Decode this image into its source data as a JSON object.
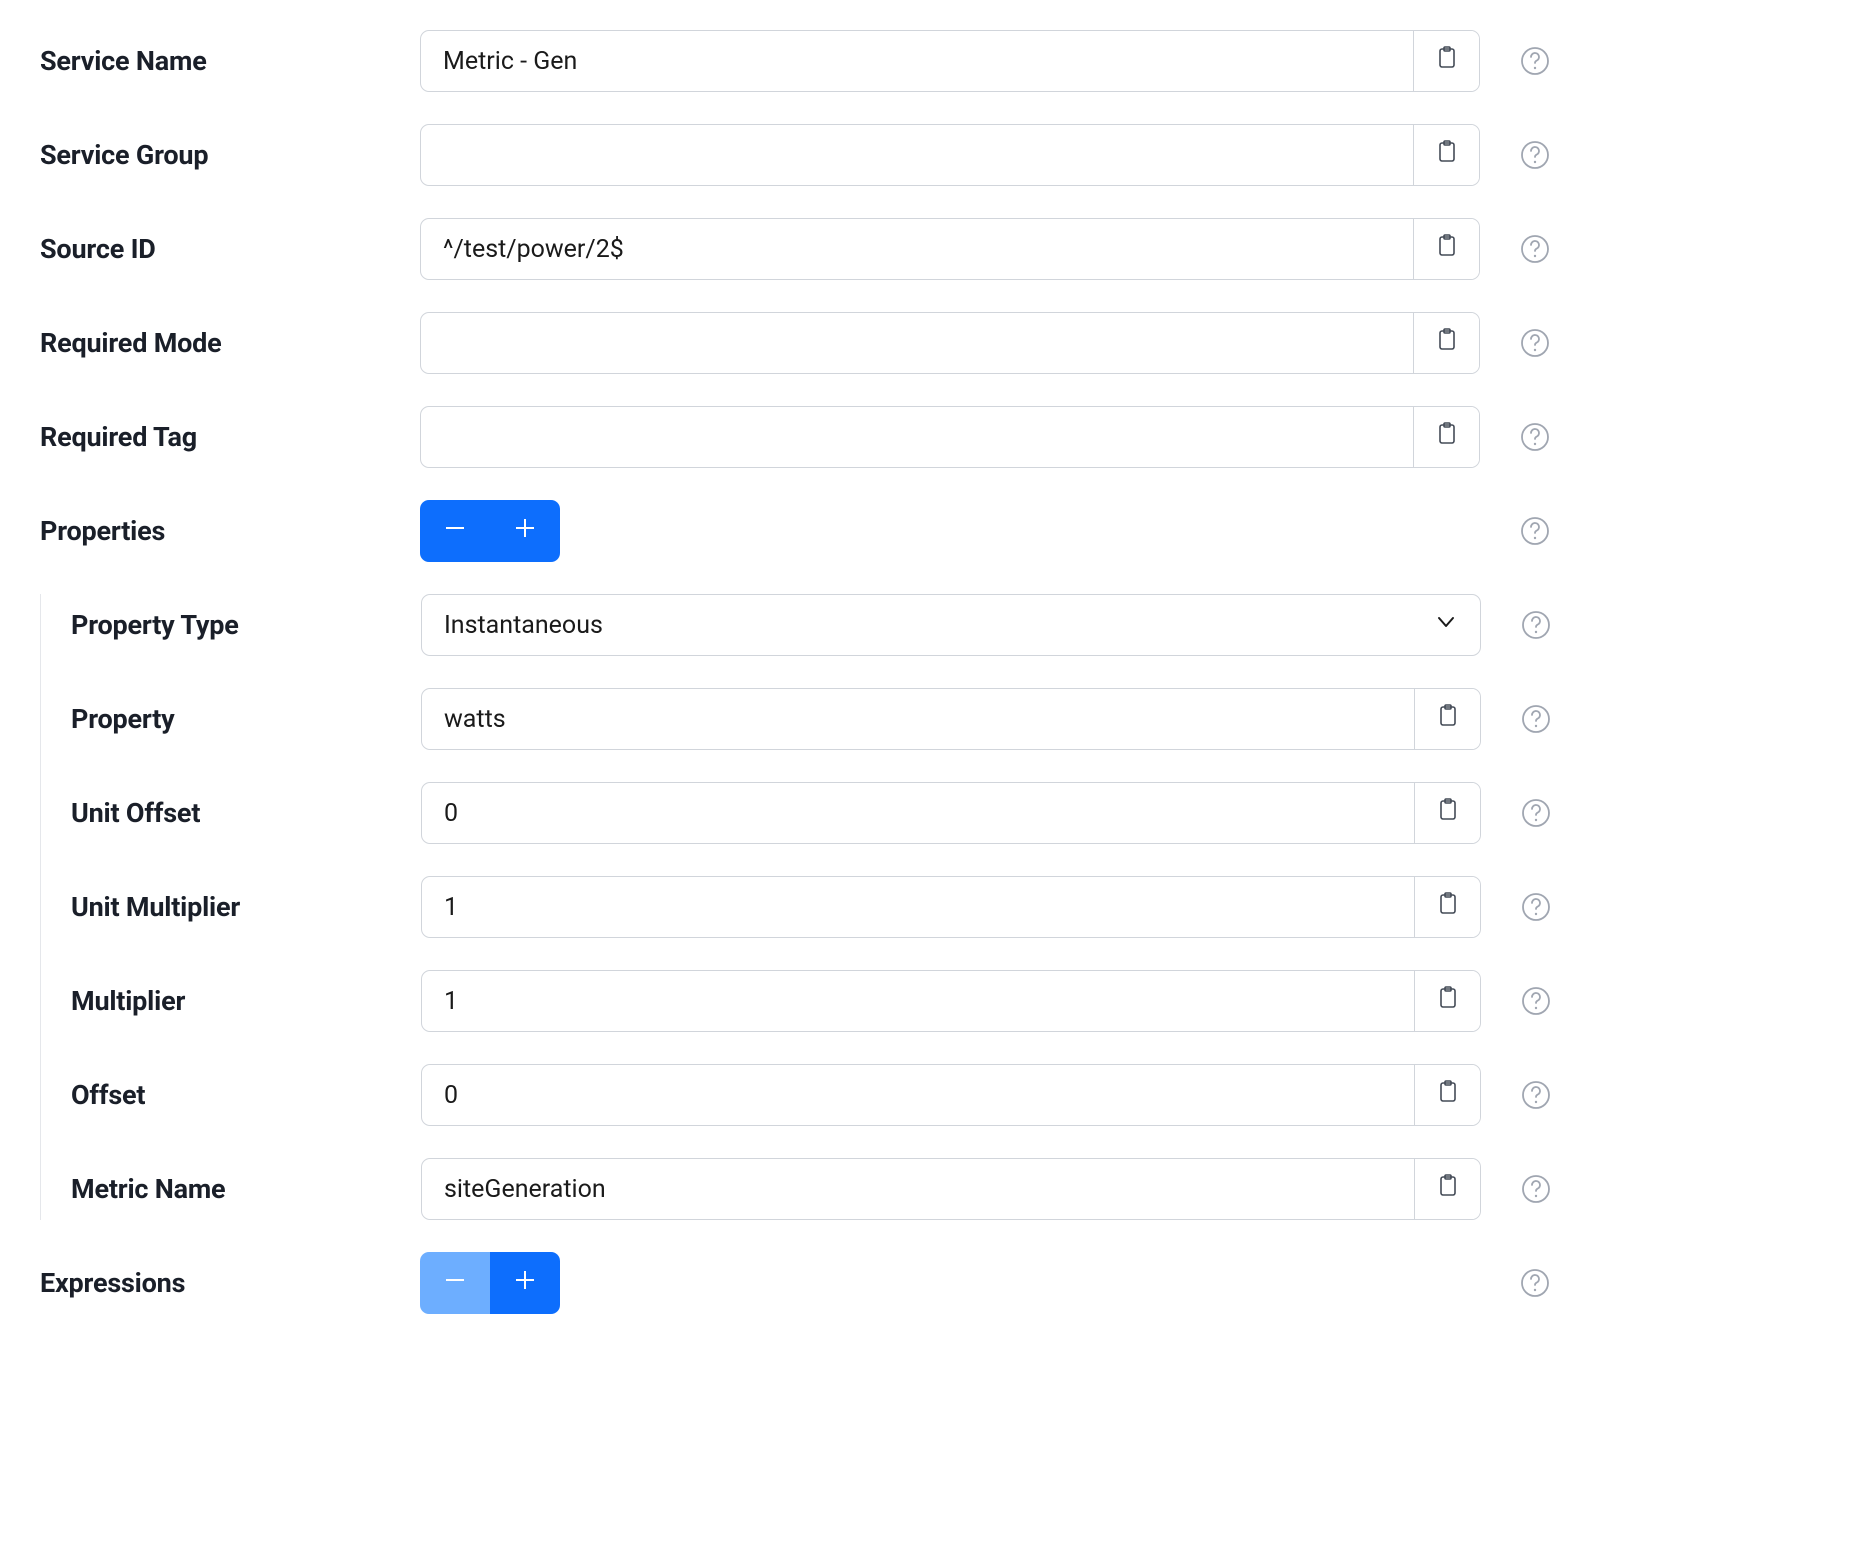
{
  "labels": {
    "service_name": "Service Name",
    "service_group": "Service Group",
    "source_id": "Source ID",
    "required_mode": "Required Mode",
    "required_tag": "Required Tag",
    "properties": "Properties",
    "property_type": "Property Type",
    "property": "Property",
    "unit_offset": "Unit Offset",
    "unit_multiplier": "Unit Multiplier",
    "multiplier": "Multiplier",
    "offset": "Offset",
    "metric_name": "Metric Name",
    "expressions": "Expressions"
  },
  "values": {
    "service_name": "Metric - Gen",
    "service_group": "",
    "source_id": "^/test/power/2$",
    "required_mode": "",
    "required_tag": "",
    "property_type": "Instantaneous",
    "property": "watts",
    "unit_offset": "0",
    "unit_multiplier": "1",
    "multiplier": "1",
    "offset": "0",
    "metric_name": "siteGeneration"
  }
}
